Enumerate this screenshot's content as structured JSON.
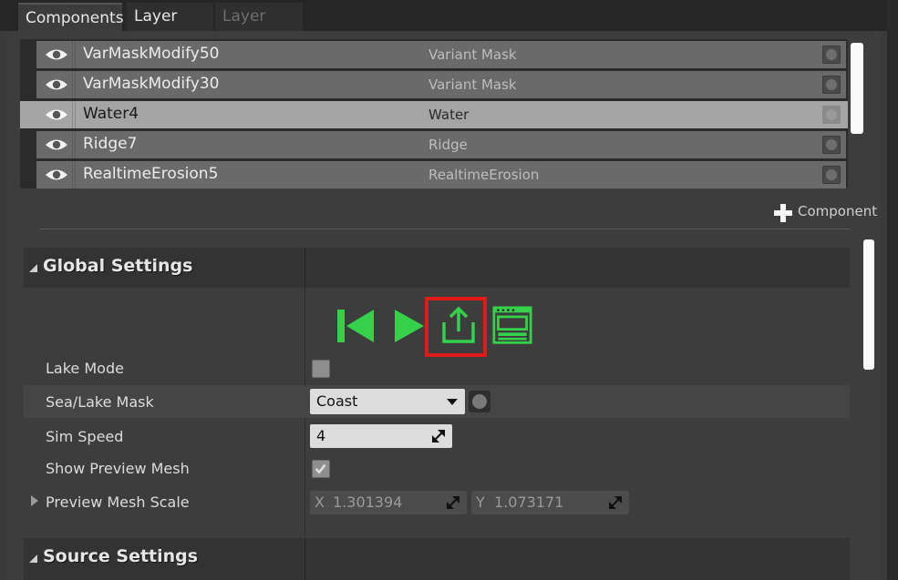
{
  "tabs": [
    {
      "label": "Components",
      "state": "active"
    },
    {
      "label": "Layer Info",
      "state": "normal"
    },
    {
      "label": "Layer Edit",
      "state": "disabled"
    }
  ],
  "components": [
    {
      "name": "VarMaskModify50",
      "type": "Variant Mask",
      "selected": false
    },
    {
      "name": "VarMaskModify30",
      "type": "Variant Mask",
      "selected": false
    },
    {
      "name": "Water4",
      "type": "Water",
      "selected": true
    },
    {
      "name": "Ridge7",
      "type": "Ridge",
      "selected": false
    },
    {
      "name": "RealtimeErosion5",
      "type": "RealtimeErosion",
      "selected": false
    }
  ],
  "add_component_label": "Component",
  "global_settings": {
    "title": "Global Settings",
    "toolbar": [
      {
        "icon": "skip-to-start-icon"
      },
      {
        "icon": "play-icon"
      },
      {
        "icon": "export-icon",
        "highlighted": true
      },
      {
        "icon": "panel-layout-icon"
      }
    ],
    "properties": {
      "lake_mode": {
        "label": "Lake Mode",
        "checked": false
      },
      "sea_lake_mask": {
        "label": "Sea/Lake Mask",
        "value": "Coast"
      },
      "sim_speed": {
        "label": "Sim Speed",
        "value": "4"
      },
      "show_preview_mesh": {
        "label": "Show Preview Mesh",
        "checked": true
      },
      "preview_mesh_scale": {
        "label": "Preview Mesh Scale",
        "x_axis": "X",
        "x": "1.301394",
        "y_axis": "Y",
        "y": "1.073171"
      }
    }
  },
  "source_settings": {
    "title": "Source Settings"
  },
  "colors": {
    "accent_green": "#35d14a",
    "highlight_red": "#e01b1b"
  }
}
